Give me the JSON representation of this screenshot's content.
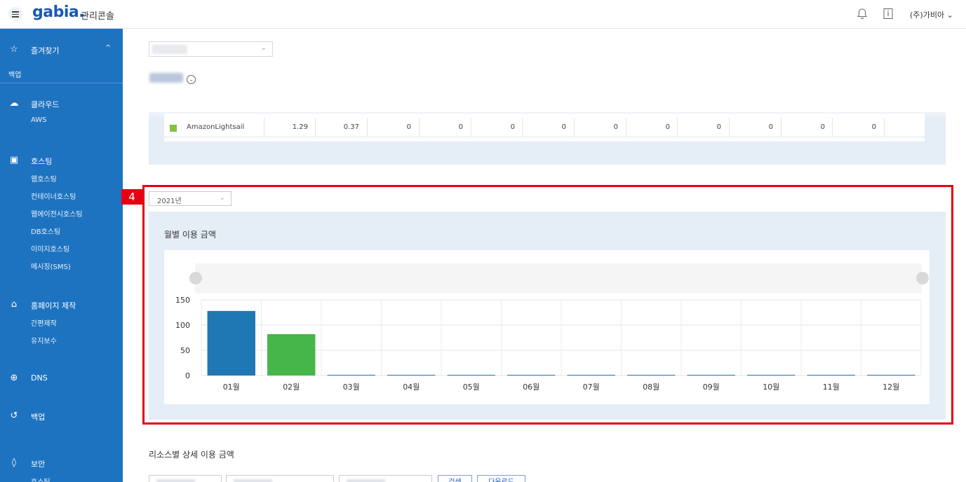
{
  "header": {
    "logo": "gabia.",
    "console_title": "관리콘솔",
    "account": "(주)가비아"
  },
  "sidebar": {
    "favorites": {
      "label": "즐겨찾기",
      "items": [
        "백업"
      ]
    },
    "cloud": {
      "label": "클라우드",
      "items": [
        "AWS"
      ]
    },
    "hosting": {
      "label": "호스팅",
      "items": [
        "웹호스팅",
        "컨테이너호스팅",
        "웹에이전시호스팅",
        "DB호스팅",
        "이미지호스팅",
        "메시징(SMS)"
      ]
    },
    "homepage": {
      "label": "홈페이지 제작",
      "items": [
        "간편제작",
        "유지보수"
      ]
    },
    "dns": {
      "label": "DNS"
    },
    "backup": {
      "label": "백업"
    },
    "security": {
      "label": "보안",
      "items": [
        "호스팅"
      ]
    }
  },
  "top_section": {
    "title": "cloud"
  },
  "table": {
    "row": {
      "name": "AmazonLightsail",
      "values": [
        "1.29",
        "0.37",
        "0",
        "0",
        "0",
        "0",
        "0",
        "0",
        "0",
        "0",
        "0",
        "0"
      ]
    }
  },
  "highlight": {
    "number": "4"
  },
  "year_select": {
    "value": "2021년"
  },
  "chart_title": "월별 이용 금액",
  "chart_data": {
    "type": "bar",
    "categories": [
      "01월",
      "02월",
      "03월",
      "04월",
      "05월",
      "06월",
      "07월",
      "08월",
      "09월",
      "10월",
      "11월",
      "12월"
    ],
    "values": [
      128,
      82,
      0,
      0,
      0,
      0,
      0,
      0,
      0,
      0,
      0,
      0
    ],
    "colors": [
      "#1f77b4",
      "#45b649",
      "#1f77b4",
      "#1f77b4",
      "#1f77b4",
      "#1f77b4",
      "#1f77b4",
      "#1f77b4",
      "#1f77b4",
      "#1f77b4",
      "#1f77b4",
      "#1f77b4"
    ],
    "yticks": [
      "150",
      "100",
      "50",
      "0"
    ],
    "ylim": [
      0,
      150
    ],
    "grid": true,
    "title": "월별 이용 금액"
  },
  "resource_title": "리소스별 상세 이용 금액",
  "bottom": {
    "search_label": "검색",
    "download_label": "다운로드"
  }
}
